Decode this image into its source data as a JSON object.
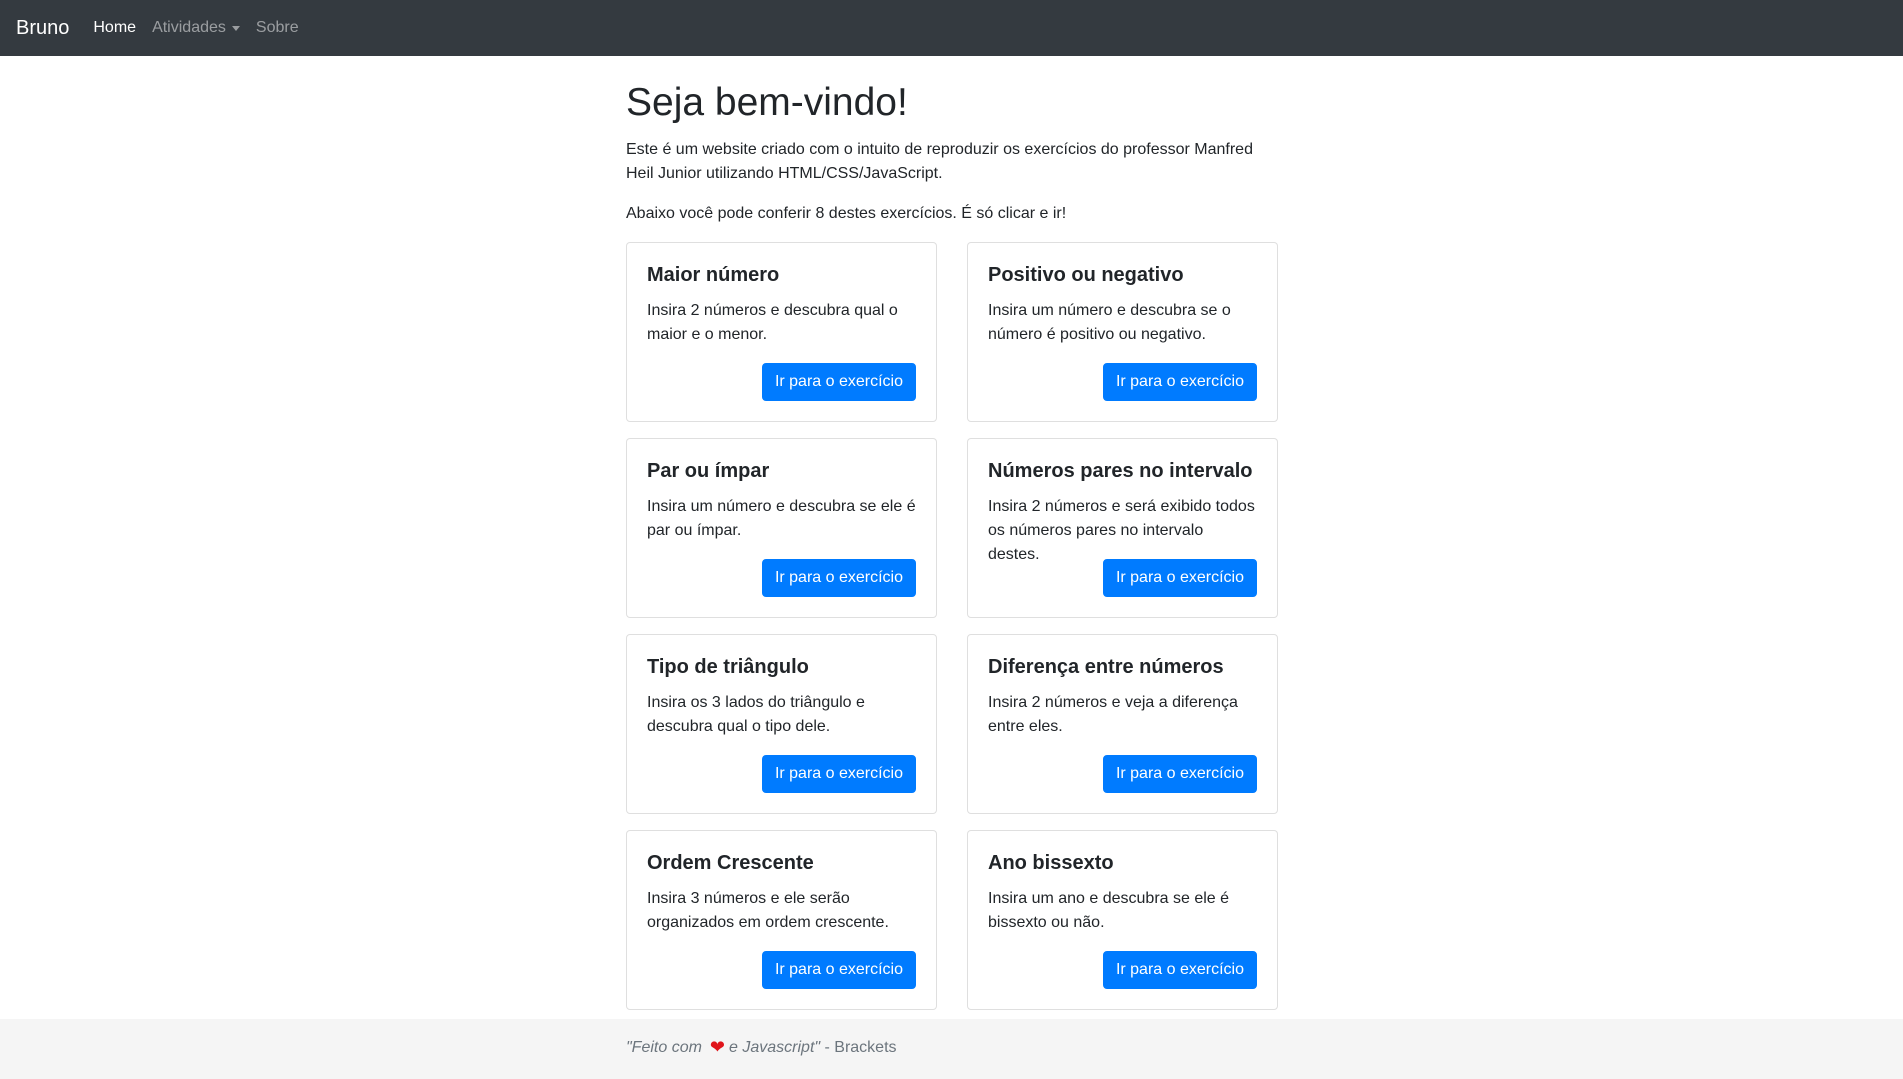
{
  "navbar": {
    "brand": "Bruno",
    "items": [
      {
        "label": "Home"
      },
      {
        "label": "Atividades"
      },
      {
        "label": "Sobre"
      }
    ]
  },
  "main": {
    "title": "Seja bem-vindo!",
    "intro": "Este é um website criado com o intuito de reproduzir os exercícios do professor Manfred Heil Junior utilizando HTML/CSS/JavaScript.",
    "subintro": "Abaixo você pode conferir 8 destes exercícios. É só clicar e ir!",
    "cards": [
      {
        "title": "Maior número",
        "text": "Insira 2 números e descubra qual o maior e o menor.",
        "button": "Ir para o exercício"
      },
      {
        "title": "Positivo ou negativo",
        "text": "Insira um número e descubra se o número é positivo ou negativo.",
        "button": "Ir para o exercício"
      },
      {
        "title": "Par ou ímpar",
        "text": "Insira um número e descubra se ele é par ou ímpar.",
        "button": "Ir para o exercício"
      },
      {
        "title": "Números pares no intervalo",
        "text": "Insira 2 números e será exibido todos os números pares no intervalo destes.",
        "button": "Ir para o exercício"
      },
      {
        "title": "Tipo de triângulo",
        "text": "Insira os 3 lados do triângulo e descubra qual o tipo dele.",
        "button": "Ir para o exercício"
      },
      {
        "title": "Diferença entre números",
        "text": "Insira 2 números e veja a diferença entre eles.",
        "button": "Ir para o exercício"
      },
      {
        "title": "Ordem Crescente",
        "text": "Insira 3 números e ele serão organizados em ordem crescente.",
        "button": "Ir para o exercício"
      },
      {
        "title": "Ano bissexto",
        "text": "Insira um ano e descubra se ele é bissexto ou não.",
        "button": "Ir para o exercício"
      }
    ]
  },
  "footer": {
    "quote_start": "\"Feito com",
    "heart": "❤",
    "quote_end": "e Javascript\"",
    "credit": " - Brackets"
  },
  "colors": {
    "navbar_bg": "#343a40",
    "primary": "#007bff",
    "footer_bg": "#f5f5f5"
  }
}
